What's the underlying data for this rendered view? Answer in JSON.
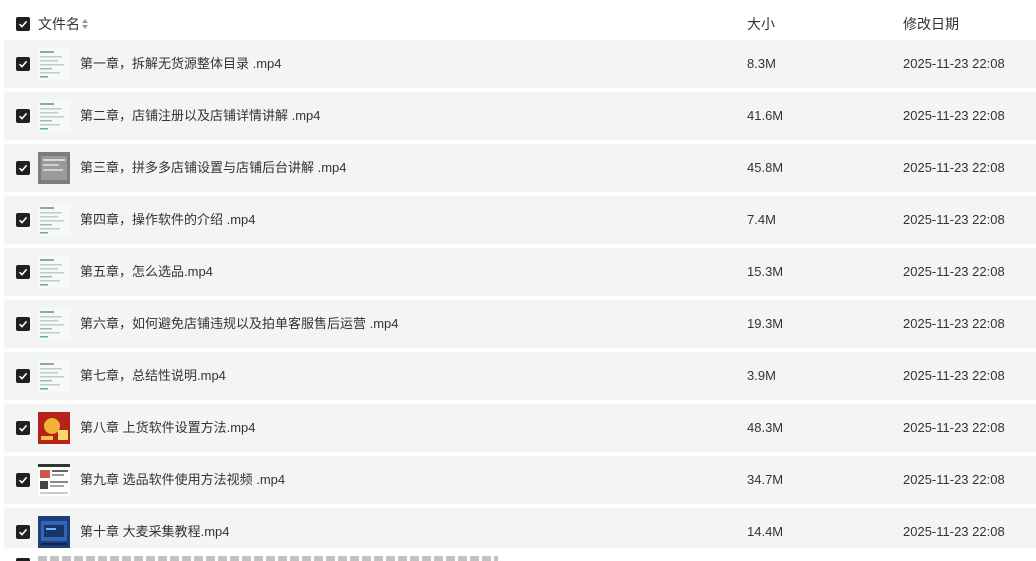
{
  "header": {
    "name_label": "文件名",
    "size_label": "大小",
    "date_label": "修改日期"
  },
  "files": [
    {
      "name": "第一章，拆解无货源整体目录 .mp4",
      "size": "8.3M",
      "modified": "2025-11-23 22:08",
      "thumb_icon": "document-thumbnail"
    },
    {
      "name": "第二章，店铺注册以及店铺详情讲解 .mp4",
      "size": "41.6M",
      "modified": "2025-11-23 22:08",
      "thumb_icon": "document-thumbnail"
    },
    {
      "name": "第三章，拼多多店铺设置与店铺后台讲解 .mp4",
      "size": "45.8M",
      "modified": "2025-11-23 22:08",
      "thumb_icon": "gray-window-thumbnail"
    },
    {
      "name": "第四章，操作软件的介绍 .mp4",
      "size": "7.4M",
      "modified": "2025-11-23 22:08",
      "thumb_icon": "document-thumbnail"
    },
    {
      "name": "第五章，怎么选品.mp4",
      "size": "15.3M",
      "modified": "2025-11-23 22:08",
      "thumb_icon": "document-thumbnail"
    },
    {
      "name": "第六章，如何避免店铺违规以及拍单客服售后运营 .mp4",
      "size": "19.3M",
      "modified": "2025-11-23 22:08",
      "thumb_icon": "document-thumbnail"
    },
    {
      "name": "第七章，总结性说明.mp4",
      "size": "3.9M",
      "modified": "2025-11-23 22:08",
      "thumb_icon": "document-thumbnail"
    },
    {
      "name": "第八章 上货软件设置方法.mp4",
      "size": "48.3M",
      "modified": "2025-11-23 22:08",
      "thumb_icon": "red-poster-thumbnail"
    },
    {
      "name": "第九章 选品软件使用方法视频 .mp4",
      "size": "34.7M",
      "modified": "2025-11-23 22:08",
      "thumb_icon": "webpage-thumbnail"
    },
    {
      "name": "第十章 大麦采集教程.mp4",
      "size": "14.4M",
      "modified": "2025-11-23 22:08",
      "thumb_icon": "blue-screen-thumbnail"
    }
  ],
  "colors": {
    "row_bg": "#f4f4f4",
    "checkbox": "#1f1f1f",
    "text": "#333333"
  }
}
